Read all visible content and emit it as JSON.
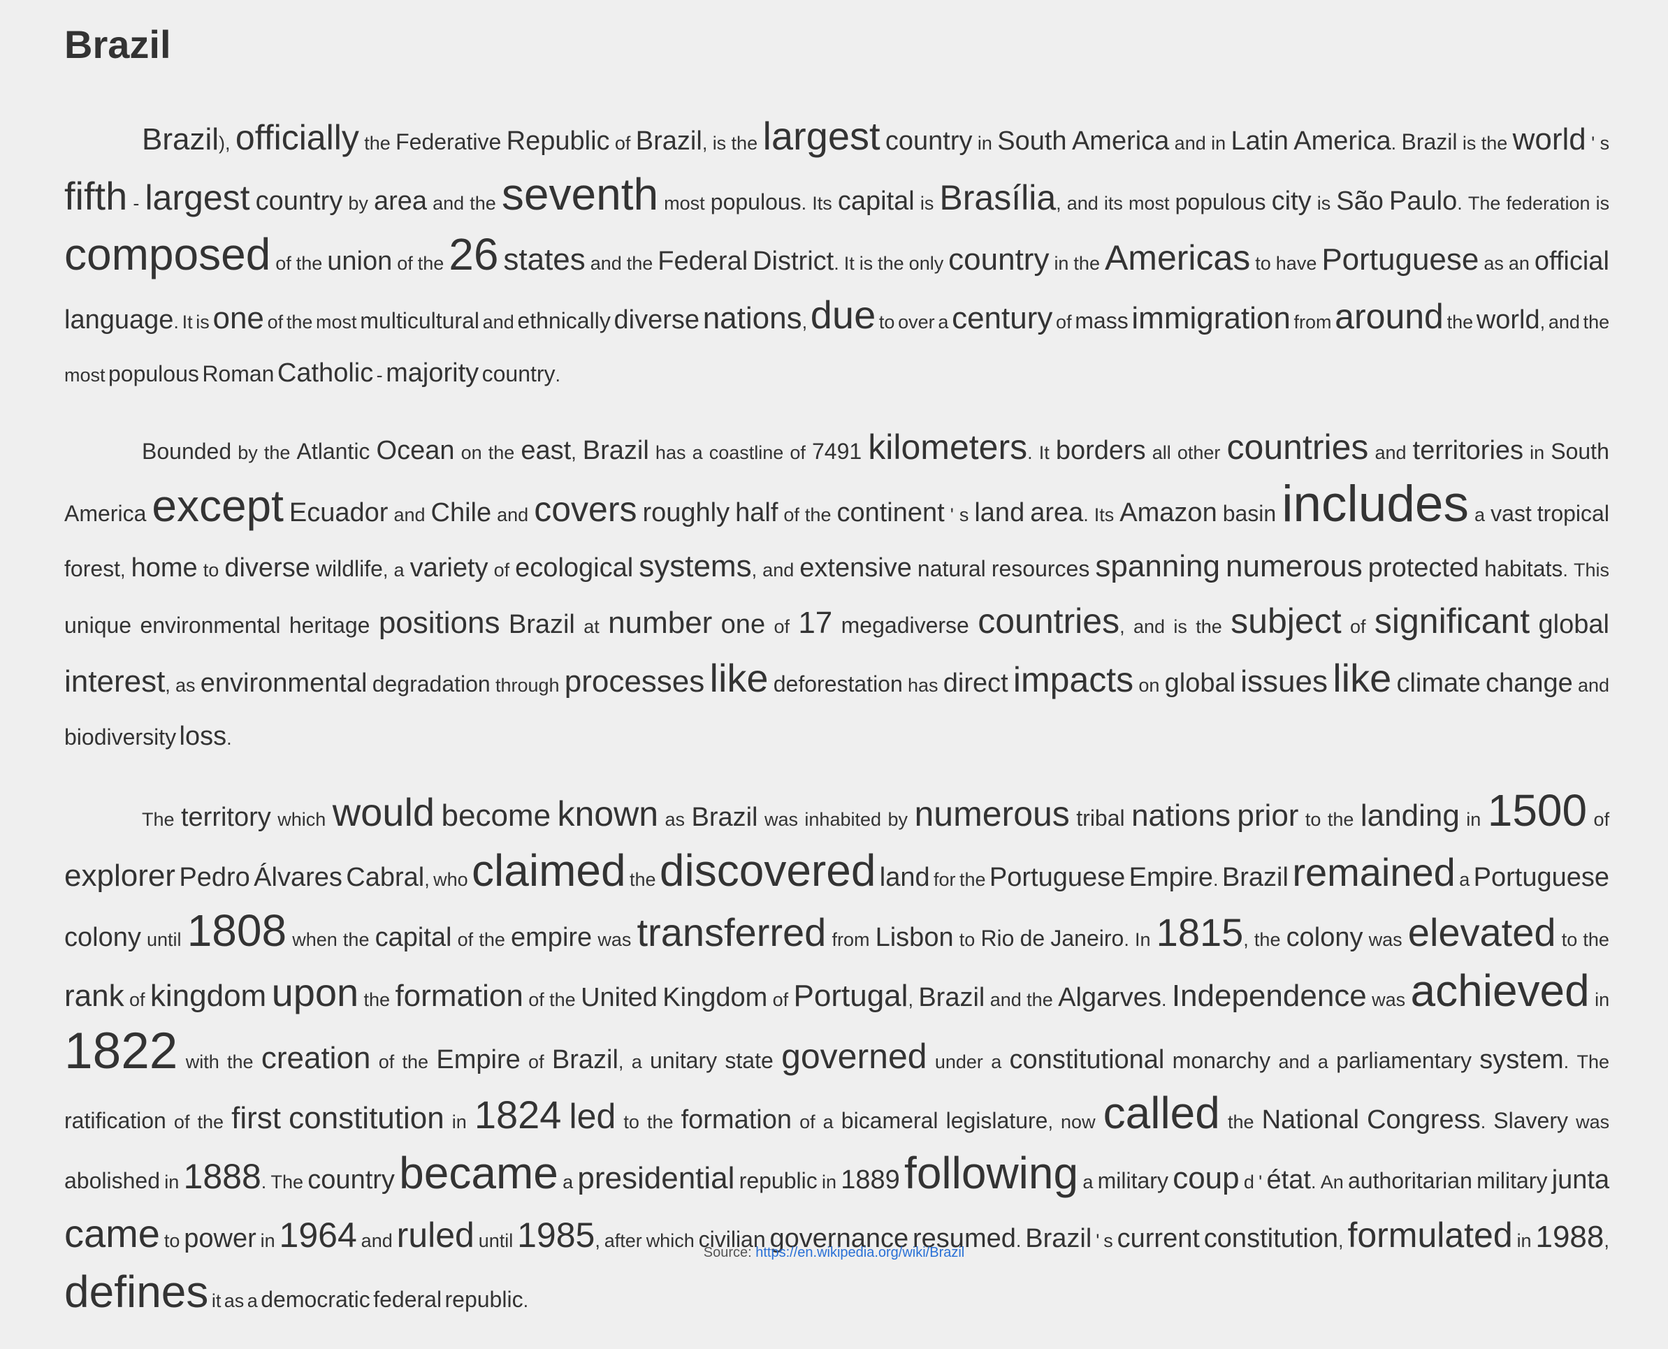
{
  "title": "Brazil",
  "paragraphs": [
    [
      [
        "Brazil",
        4
      ],
      [
        ")",
        1
      ],
      [
        ",",
        1
      ],
      [
        "officially",
        5
      ],
      [
        "the",
        1
      ],
      [
        "Federative",
        2
      ],
      [
        "Republic",
        3
      ],
      [
        "of",
        1
      ],
      [
        "Brazil",
        3
      ],
      [
        ",",
        1
      ],
      [
        "is",
        1
      ],
      [
        "the",
        1
      ],
      [
        "largest",
        6
      ],
      [
        "country",
        3
      ],
      [
        "in",
        1
      ],
      [
        "South",
        3
      ],
      [
        "America",
        3
      ],
      [
        "and",
        1
      ],
      [
        "in",
        1
      ],
      [
        "Latin",
        3
      ],
      [
        "America",
        3
      ],
      [
        ".",
        1
      ],
      [
        "Brazil",
        2
      ],
      [
        "is",
        1
      ],
      [
        "the",
        1
      ],
      [
        "world",
        4
      ],
      [
        "'",
        1
      ],
      [
        "s",
        1
      ],
      [
        "fifth",
        6
      ],
      [
        "-",
        1
      ],
      [
        "largest",
        5
      ],
      [
        "country",
        3
      ],
      [
        "by",
        1
      ],
      [
        "area",
        3
      ],
      [
        "and",
        1
      ],
      [
        "the",
        1
      ],
      [
        "seventh",
        7
      ],
      [
        "most",
        1
      ],
      [
        "populous",
        2
      ],
      [
        ".",
        1
      ],
      [
        "Its",
        1
      ],
      [
        "capital",
        3
      ],
      [
        "is",
        1
      ],
      [
        "Brasília",
        5
      ],
      [
        ",",
        1
      ],
      [
        "and",
        1
      ],
      [
        "its",
        1
      ],
      [
        "most",
        1
      ],
      [
        "populous",
        2
      ],
      [
        "city",
        3
      ],
      [
        "is",
        1
      ],
      [
        "São",
        3
      ],
      [
        "Paulo",
        3
      ],
      [
        ".",
        1
      ],
      [
        "The",
        1
      ],
      [
        "federation",
        1
      ],
      [
        "is",
        1
      ],
      [
        "composed",
        7
      ],
      [
        "of",
        1
      ],
      [
        "the",
        1
      ],
      [
        "union",
        3
      ],
      [
        "of",
        1
      ],
      [
        "the",
        1
      ],
      [
        "26",
        7
      ],
      [
        "states",
        4
      ],
      [
        "and",
        1
      ],
      [
        "the",
        1
      ],
      [
        "Federal",
        3
      ],
      [
        "District",
        3
      ],
      [
        ".",
        1
      ],
      [
        "It",
        1
      ],
      [
        "is",
        1
      ],
      [
        "the",
        1
      ],
      [
        "only",
        1
      ],
      [
        "country",
        4
      ],
      [
        "in",
        1
      ],
      [
        "the",
        1
      ],
      [
        "Americas",
        5
      ],
      [
        "to",
        1
      ],
      [
        "have",
        1
      ],
      [
        "Portuguese",
        4
      ],
      [
        "as",
        1
      ],
      [
        "an",
        1
      ],
      [
        "official",
        3
      ],
      [
        "language",
        3
      ],
      [
        ".",
        1
      ],
      [
        "It",
        1
      ],
      [
        "is",
        1
      ],
      [
        "one",
        4
      ],
      [
        "of",
        1
      ],
      [
        "the",
        1
      ],
      [
        "most",
        1
      ],
      [
        "multicultural",
        2
      ],
      [
        "and",
        1
      ],
      [
        "ethnically",
        2
      ],
      [
        "diverse",
        3
      ],
      [
        "nations",
        4
      ],
      [
        ",",
        1
      ],
      [
        "due",
        6
      ],
      [
        "to",
        1
      ],
      [
        "over",
        1
      ],
      [
        "a",
        1
      ],
      [
        "century",
        4
      ],
      [
        "of",
        1
      ],
      [
        "mass",
        2
      ],
      [
        "immigration",
        4
      ],
      [
        "from",
        1
      ],
      [
        "around",
        5
      ],
      [
        "the",
        1
      ],
      [
        "world",
        3
      ],
      [
        ",",
        1
      ],
      [
        "and",
        1
      ],
      [
        "the",
        1
      ],
      [
        "most",
        1
      ],
      [
        "populous",
        2
      ],
      [
        "Roman",
        2
      ],
      [
        "Catholic",
        3
      ],
      [
        "-",
        1
      ],
      [
        "majority",
        3
      ],
      [
        "country",
        2
      ],
      [
        ".",
        1
      ]
    ],
    [
      [
        "Bounded",
        2
      ],
      [
        "by",
        1
      ],
      [
        "the",
        1
      ],
      [
        "Atlantic",
        2
      ],
      [
        "Ocean",
        3
      ],
      [
        "on",
        1
      ],
      [
        "the",
        1
      ],
      [
        "east",
        3
      ],
      [
        ",",
        1
      ],
      [
        "Brazil",
        3
      ],
      [
        "has",
        1
      ],
      [
        "a",
        1
      ],
      [
        "coastline",
        1
      ],
      [
        "of",
        1
      ],
      [
        "7491",
        2
      ],
      [
        "kilometers",
        5
      ],
      [
        ".",
        1
      ],
      [
        "It",
        1
      ],
      [
        "borders",
        3
      ],
      [
        "all",
        1
      ],
      [
        "other",
        1
      ],
      [
        "countries",
        5
      ],
      [
        "and",
        1
      ],
      [
        "territories",
        3
      ],
      [
        "in",
        1
      ],
      [
        "South",
        2
      ],
      [
        "America",
        2
      ],
      [
        "except",
        7
      ],
      [
        "Ecuador",
        3
      ],
      [
        "and",
        1
      ],
      [
        "Chile",
        3
      ],
      [
        "and",
        1
      ],
      [
        "covers",
        5
      ],
      [
        "roughly",
        3
      ],
      [
        "half",
        3
      ],
      [
        "of",
        1
      ],
      [
        "the",
        1
      ],
      [
        "continent",
        3
      ],
      [
        "'",
        1
      ],
      [
        "s",
        1
      ],
      [
        "land",
        3
      ],
      [
        "area",
        3
      ],
      [
        ".",
        1
      ],
      [
        "Its",
        1
      ],
      [
        "Amazon",
        3
      ],
      [
        "basin",
        2
      ],
      [
        "includes",
        8
      ],
      [
        "a",
        1
      ],
      [
        "vast",
        2
      ],
      [
        "tropical",
        2
      ],
      [
        "forest",
        2
      ],
      [
        ",",
        1
      ],
      [
        "home",
        3
      ],
      [
        "to",
        1
      ],
      [
        "diverse",
        3
      ],
      [
        "wildlife",
        2
      ],
      [
        ",",
        1
      ],
      [
        "a",
        1
      ],
      [
        "variety",
        3
      ],
      [
        "of",
        1
      ],
      [
        "ecological",
        3
      ],
      [
        "systems",
        4
      ],
      [
        ",",
        1
      ],
      [
        "and",
        1
      ],
      [
        "extensive",
        3
      ],
      [
        "natural",
        2
      ],
      [
        "resources",
        2
      ],
      [
        "spanning",
        4
      ],
      [
        "numerous",
        4
      ],
      [
        "protected",
        3
      ],
      [
        "habitats",
        2
      ],
      [
        ".",
        1
      ],
      [
        "This",
        1
      ],
      [
        "unique",
        2
      ],
      [
        "environmental",
        2
      ],
      [
        "heritage",
        2
      ],
      [
        "positions",
        4
      ],
      [
        "Brazil",
        3
      ],
      [
        "at",
        1
      ],
      [
        "number",
        4
      ],
      [
        "one",
        3
      ],
      [
        "of",
        1
      ],
      [
        "17",
        4
      ],
      [
        "megadiverse",
        2
      ],
      [
        "countries",
        5
      ],
      [
        ",",
        1
      ],
      [
        "and",
        1
      ],
      [
        "is",
        1
      ],
      [
        "the",
        1
      ],
      [
        "subject",
        5
      ],
      [
        "of",
        1
      ],
      [
        "significant",
        5
      ],
      [
        "global",
        3
      ],
      [
        "interest",
        4
      ],
      [
        ",",
        1
      ],
      [
        "as",
        1
      ],
      [
        "environmental",
        3
      ],
      [
        "degradation",
        2
      ],
      [
        "through",
        1
      ],
      [
        "processes",
        4
      ],
      [
        "like",
        6
      ],
      [
        "deforestation",
        2
      ],
      [
        "has",
        1
      ],
      [
        "direct",
        3
      ],
      [
        "impacts",
        5
      ],
      [
        "on",
        1
      ],
      [
        "global",
        3
      ],
      [
        "issues",
        4
      ],
      [
        "like",
        6
      ],
      [
        "climate",
        3
      ],
      [
        "change",
        3
      ],
      [
        "and",
        1
      ],
      [
        "biodiversity",
        2
      ],
      [
        "loss",
        3
      ],
      [
        ".",
        1
      ]
    ],
    [
      [
        "The",
        1
      ],
      [
        "territory",
        3
      ],
      [
        "which",
        1
      ],
      [
        "would",
        6
      ],
      [
        "become",
        4
      ],
      [
        "known",
        5
      ],
      [
        "as",
        1
      ],
      [
        "Brazil",
        3
      ],
      [
        "was",
        1
      ],
      [
        "inhabited",
        1
      ],
      [
        "by",
        1
      ],
      [
        "numerous",
        5
      ],
      [
        "tribal",
        2
      ],
      [
        "nations",
        4
      ],
      [
        "prior",
        4
      ],
      [
        "to",
        1
      ],
      [
        "the",
        1
      ],
      [
        "landing",
        4
      ],
      [
        "in",
        1
      ],
      [
        "1500",
        7
      ],
      [
        "of",
        1
      ],
      [
        "explorer",
        4
      ],
      [
        "Pedro",
        3
      ],
      [
        "Álvares",
        3
      ],
      [
        "Cabral",
        3
      ],
      [
        ",",
        1
      ],
      [
        "who",
        1
      ],
      [
        "claimed",
        7
      ],
      [
        "the",
        1
      ],
      [
        "discovered",
        7
      ],
      [
        "land",
        3
      ],
      [
        "for",
        1
      ],
      [
        "the",
        1
      ],
      [
        "Portuguese",
        3
      ],
      [
        "Empire",
        3
      ],
      [
        ".",
        1
      ],
      [
        "Brazil",
        3
      ],
      [
        "remained",
        6
      ],
      [
        "a",
        1
      ],
      [
        "Portuguese",
        3
      ],
      [
        "colony",
        3
      ],
      [
        "until",
        1
      ],
      [
        "1808",
        7
      ],
      [
        "when",
        1
      ],
      [
        "the",
        1
      ],
      [
        "capital",
        3
      ],
      [
        "of",
        1
      ],
      [
        "the",
        1
      ],
      [
        "empire",
        3
      ],
      [
        "was",
        1
      ],
      [
        "transferred",
        6
      ],
      [
        "from",
        1
      ],
      [
        "Lisbon",
        3
      ],
      [
        "to",
        1
      ],
      [
        "Rio",
        2
      ],
      [
        "de",
        2
      ],
      [
        "Janeiro",
        2
      ],
      [
        ".",
        1
      ],
      [
        "In",
        1
      ],
      [
        "1815",
        6
      ],
      [
        ",",
        1
      ],
      [
        "the",
        1
      ],
      [
        "colony",
        3
      ],
      [
        "was",
        1
      ],
      [
        "elevated",
        6
      ],
      [
        "to",
        1
      ],
      [
        "the",
        1
      ],
      [
        "rank",
        4
      ],
      [
        "of",
        1
      ],
      [
        "kingdom",
        4
      ],
      [
        "upon",
        6
      ],
      [
        "the",
        1
      ],
      [
        "formation",
        4
      ],
      [
        "of",
        1
      ],
      [
        "the",
        1
      ],
      [
        "United",
        3
      ],
      [
        "Kingdom",
        3
      ],
      [
        "of",
        1
      ],
      [
        "Portugal",
        4
      ],
      [
        ",",
        1
      ],
      [
        "Brazil",
        3
      ],
      [
        "and",
        1
      ],
      [
        "the",
        1
      ],
      [
        "Algarves",
        3
      ],
      [
        ".",
        1
      ],
      [
        "Independence",
        4
      ],
      [
        "was",
        1
      ],
      [
        "achieved",
        7
      ],
      [
        "in",
        1
      ],
      [
        "1822",
        8
      ],
      [
        "with",
        1
      ],
      [
        "the",
        1
      ],
      [
        "creation",
        4
      ],
      [
        "of",
        1
      ],
      [
        "the",
        1
      ],
      [
        "Empire",
        3
      ],
      [
        "of",
        1
      ],
      [
        "Brazil",
        3
      ],
      [
        ",",
        1
      ],
      [
        "a",
        1
      ],
      [
        "unitary",
        2
      ],
      [
        "state",
        2
      ],
      [
        "governed",
        5
      ],
      [
        "under",
        1
      ],
      [
        "a",
        1
      ],
      [
        "constitutional",
        3
      ],
      [
        "monarchy",
        2
      ],
      [
        "and",
        1
      ],
      [
        "a",
        1
      ],
      [
        "parliamentary",
        2
      ],
      [
        "system",
        3
      ],
      [
        ".",
        1
      ],
      [
        "The",
        1
      ],
      [
        "ratification",
        2
      ],
      [
        "of",
        1
      ],
      [
        "the",
        1
      ],
      [
        "first",
        4
      ],
      [
        "constitution",
        4
      ],
      [
        "in",
        1
      ],
      [
        "1824",
        6
      ],
      [
        "led",
        5
      ],
      [
        "to",
        1
      ],
      [
        "the",
        1
      ],
      [
        "formation",
        3
      ],
      [
        "of",
        1
      ],
      [
        "a",
        1
      ],
      [
        "bicameral",
        2
      ],
      [
        "legislature",
        2
      ],
      [
        ",",
        1
      ],
      [
        "now",
        1
      ],
      [
        "called",
        7
      ],
      [
        "the",
        1
      ],
      [
        "National",
        3
      ],
      [
        "Congress",
        3
      ],
      [
        ".",
        1
      ],
      [
        "Slavery",
        2
      ],
      [
        "was",
        1
      ],
      [
        "abolished",
        2
      ],
      [
        "in",
        1
      ],
      [
        "1888",
        5
      ],
      [
        ".",
        1
      ],
      [
        "The",
        1
      ],
      [
        "country",
        3
      ],
      [
        "became",
        7
      ],
      [
        "a",
        1
      ],
      [
        "presidential",
        4
      ],
      [
        "republic",
        2
      ],
      [
        "in",
        1
      ],
      [
        "1889",
        3
      ],
      [
        "following",
        7
      ],
      [
        "a",
        1
      ],
      [
        "military",
        2
      ],
      [
        "coup",
        4
      ],
      [
        "d",
        1
      ],
      [
        "'",
        1
      ],
      [
        "état",
        3
      ],
      [
        ".",
        1
      ],
      [
        "An",
        1
      ],
      [
        "authoritarian",
        2
      ],
      [
        "military",
        2
      ],
      [
        "junta",
        3
      ],
      [
        "came",
        6
      ],
      [
        "to",
        1
      ],
      [
        "power",
        3
      ],
      [
        "in",
        1
      ],
      [
        "1964",
        5
      ],
      [
        "and",
        1
      ],
      [
        "ruled",
        5
      ],
      [
        "until",
        1
      ],
      [
        "1985",
        5
      ],
      [
        ",",
        1
      ],
      [
        "after",
        1
      ],
      [
        "which",
        1
      ],
      [
        "civilian",
        2
      ],
      [
        "governance",
        3
      ],
      [
        "resumed",
        3
      ],
      [
        ".",
        1
      ],
      [
        "Brazil",
        3
      ],
      [
        "'",
        1
      ],
      [
        "s",
        1
      ],
      [
        "current",
        3
      ],
      [
        "constitution",
        3
      ],
      [
        ",",
        1
      ],
      [
        "formulated",
        5
      ],
      [
        "in",
        1
      ],
      [
        "1988",
        4
      ],
      [
        ",",
        1
      ],
      [
        "defines",
        7
      ],
      [
        "it",
        1
      ],
      [
        "as",
        1
      ],
      [
        "a",
        1
      ],
      [
        "democratic",
        2
      ],
      [
        "federal",
        2
      ],
      [
        "republic",
        2
      ],
      [
        ".",
        1
      ]
    ]
  ],
  "source": {
    "label": "Source:",
    "link_text": "https://en.wikipedia.org/wiki/Brazil"
  }
}
